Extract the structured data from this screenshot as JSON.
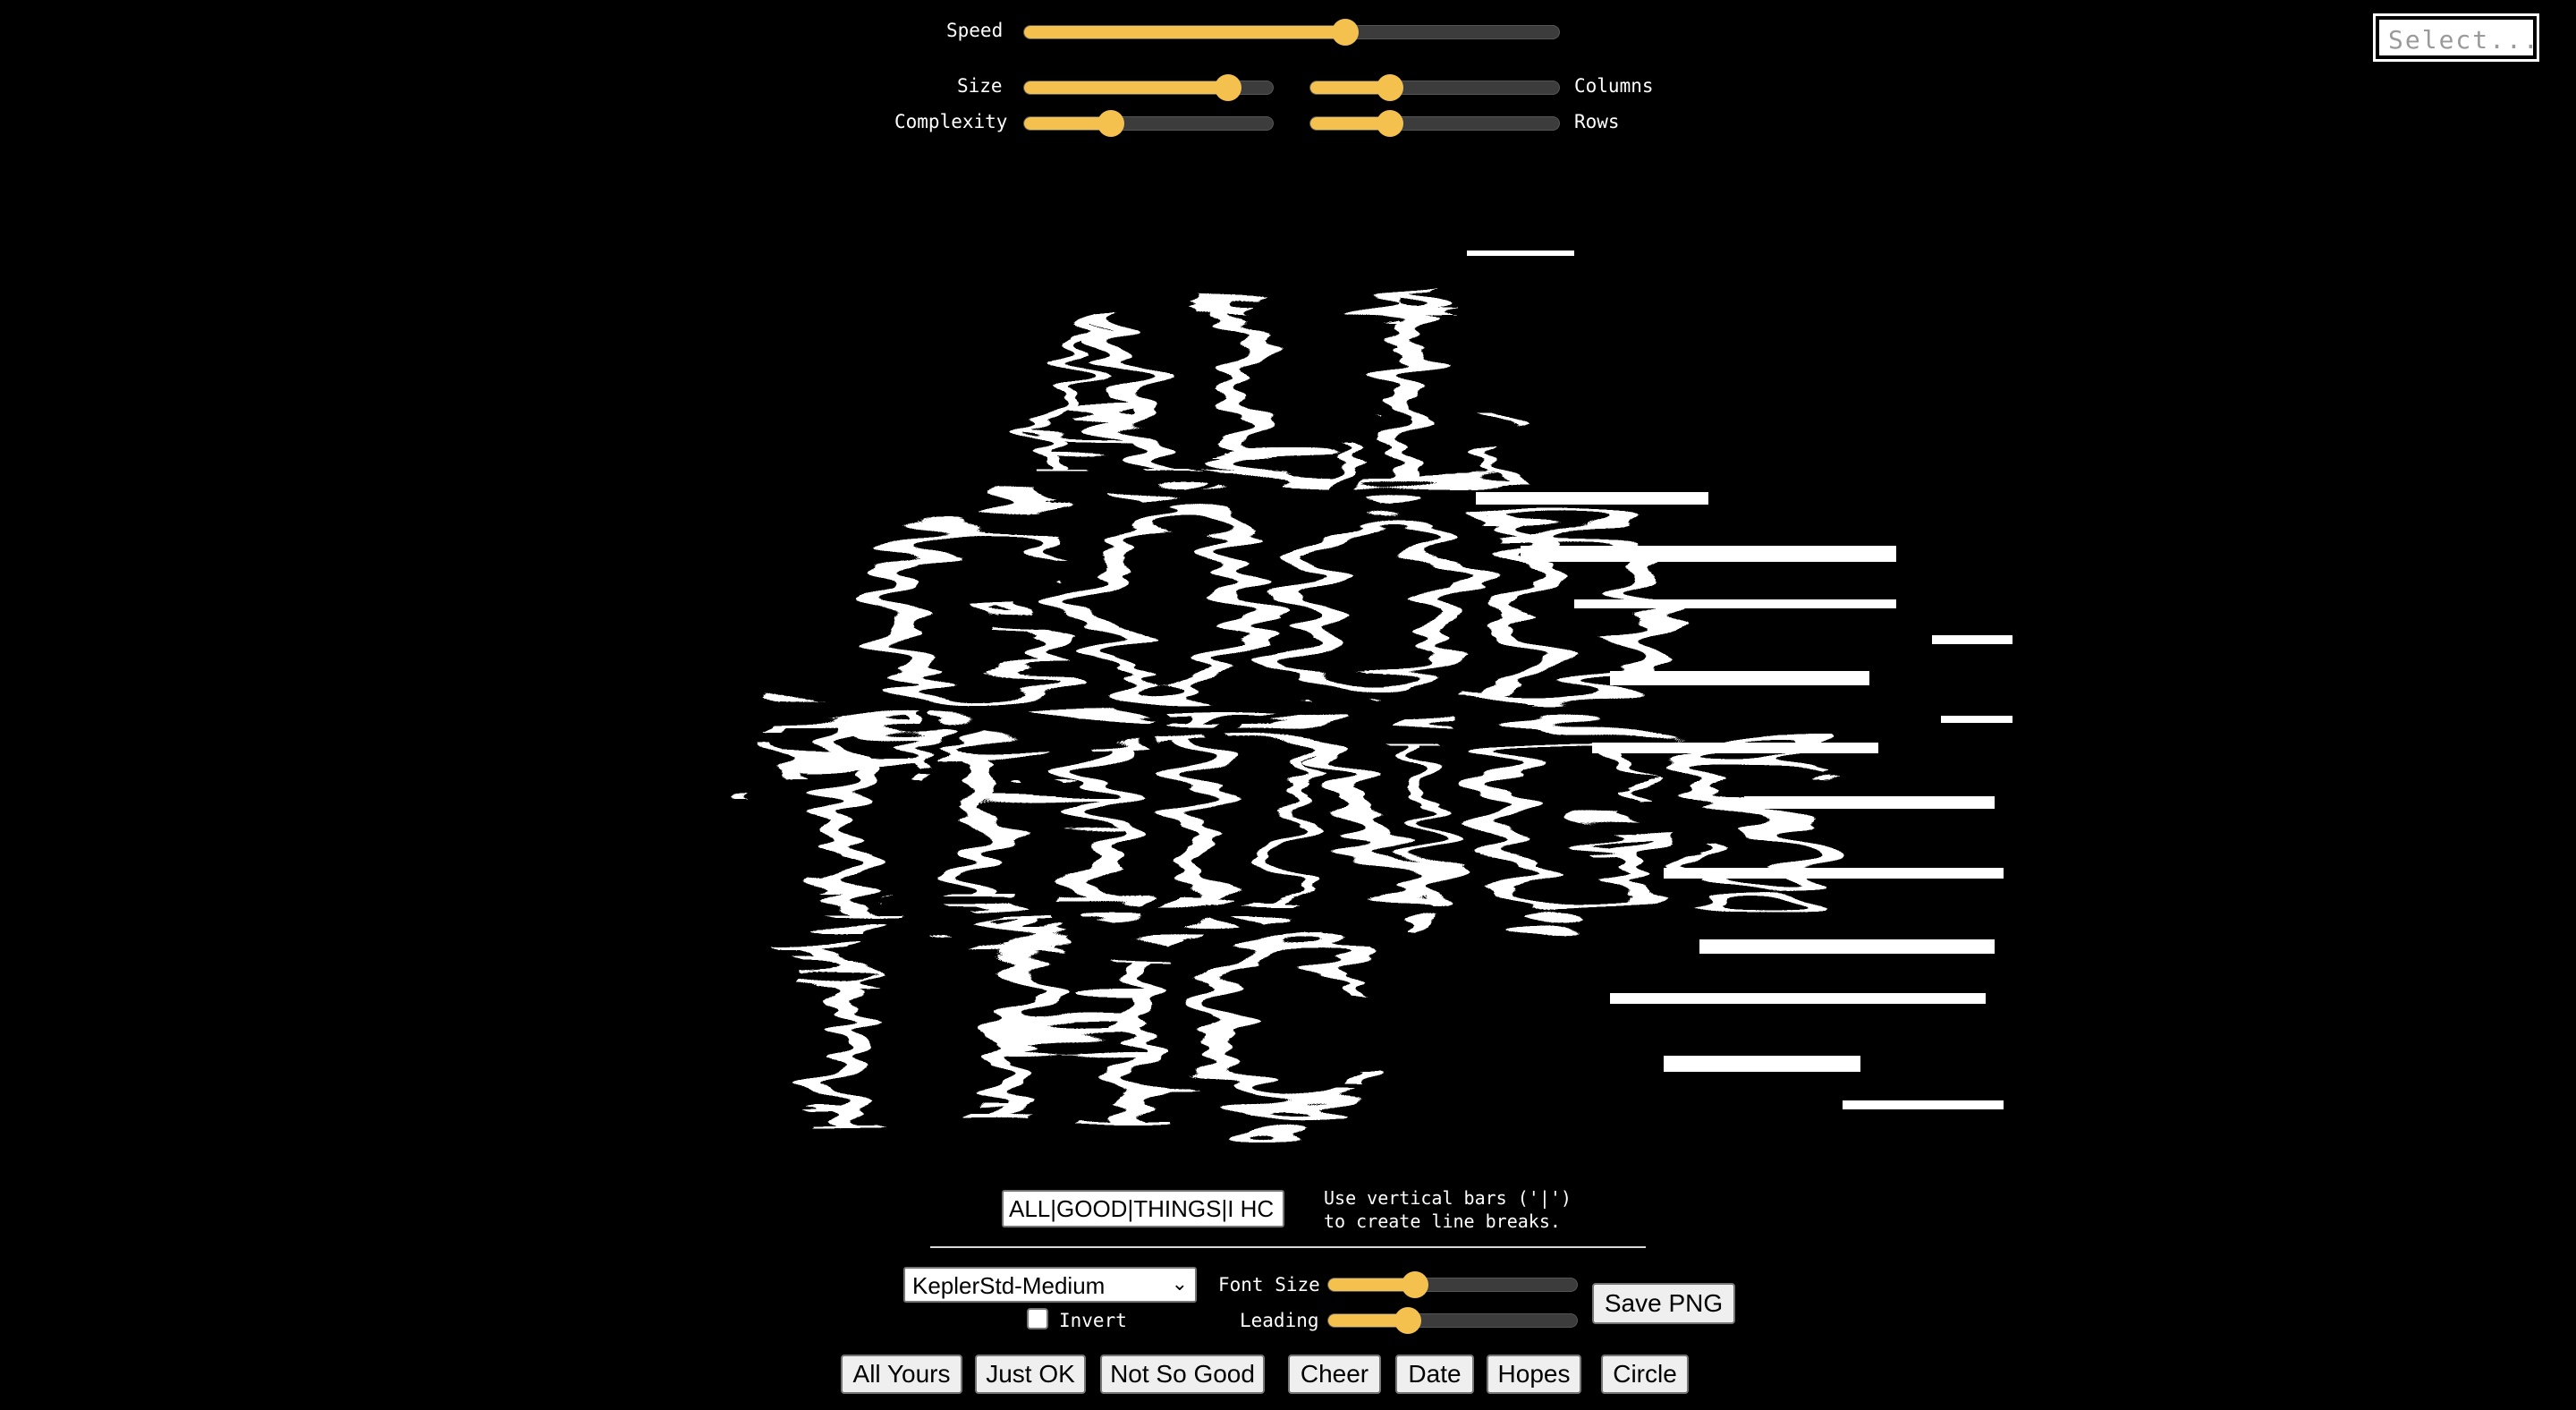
{
  "controls": {
    "speed_label": "Speed",
    "size_label": "Size",
    "complexity_label": "Complexity",
    "columns_label": "Columns",
    "rows_label": "Rows",
    "speed_value": 0.6,
    "size_value": 0.82,
    "complexity_value": 0.35,
    "columns_value": 0.32,
    "rows_value": 0.32
  },
  "top_select": {
    "placeholder": "Select..."
  },
  "poster": {
    "lines": [
      "ALL",
      "GOOD",
      "THINGS",
      "I HC"
    ],
    "color": "#ffffff"
  },
  "text_input": {
    "value": "ALL|GOOD|THINGS|I HC",
    "hint_line1": "Use vertical bars ('|')",
    "hint_line2": "to create line breaks."
  },
  "bottom_controls": {
    "font_select_value": "KeplerStd-Medium",
    "invert_label": "Invert",
    "font_size_label": "Font Size",
    "leading_label": "Leading",
    "font_size_value": 0.35,
    "leading_value": 0.32,
    "save_label": "Save PNG"
  },
  "presets": [
    "All Yours",
    "Just OK",
    "Not So Good",
    "Cheer",
    "Date",
    "Hopes",
    "Circle"
  ],
  "colors": {
    "accent": "#f4c14f",
    "background": "#000000",
    "track": "#3c3c3c"
  }
}
